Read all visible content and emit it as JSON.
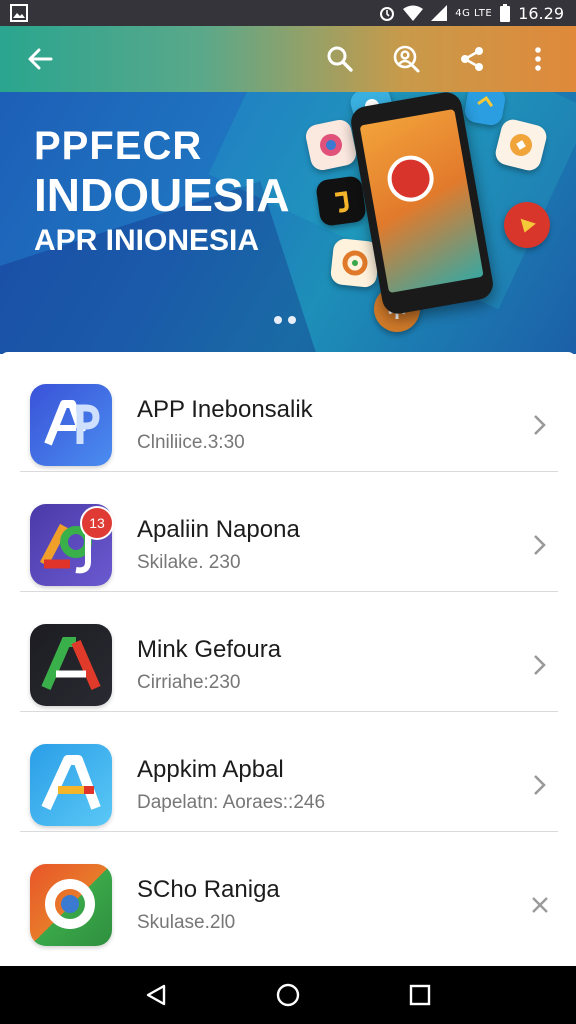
{
  "status_bar": {
    "carrier_text": "4G LTE",
    "time": "16.29"
  },
  "toolbar": {
    "back_icon": "arrow-left-icon",
    "search_icon": "search-icon",
    "account_icon": "account-search-icon",
    "share_icon": "share-icon",
    "more_icon": "more-vert-icon"
  },
  "banner": {
    "line1": "PPFECR",
    "line2": "INDOUESIA",
    "line3": "APR INIONESIA",
    "page_count": 2
  },
  "apps": [
    {
      "name": "APP Inebonsalik",
      "subtitle": "Clniliice.3:30",
      "icon_letter": "AP",
      "colors": [
        "#3a52d8",
        "#4a8df0"
      ]
    },
    {
      "name": "Apaliin Napona",
      "subtitle": "Skilake. 230",
      "icon_letter": "g",
      "badge": "13",
      "colors": [
        "#4a3aa8",
        "#6a5ad0"
      ]
    },
    {
      "name": "Mink Gefoura",
      "subtitle": "Cirriahe:230",
      "icon_letter": "A",
      "colors": [
        "#1c1c22",
        "#2a2a32"
      ]
    },
    {
      "name": "Appkim Apbal",
      "subtitle": "Dapelatn: Aoraes::246",
      "icon_letter": "A",
      "colors": [
        "#2a9ee8",
        "#5ac8f5"
      ]
    },
    {
      "name": "SCho Raniga",
      "subtitle": "Skulase.2l0",
      "icon_letter": "C",
      "colors": [
        "#e8552a",
        "#3aa84a"
      ]
    }
  ],
  "nav": {
    "back_icon": "nav-back-icon",
    "home_icon": "nav-home-icon",
    "recents_icon": "nav-recents-icon"
  }
}
